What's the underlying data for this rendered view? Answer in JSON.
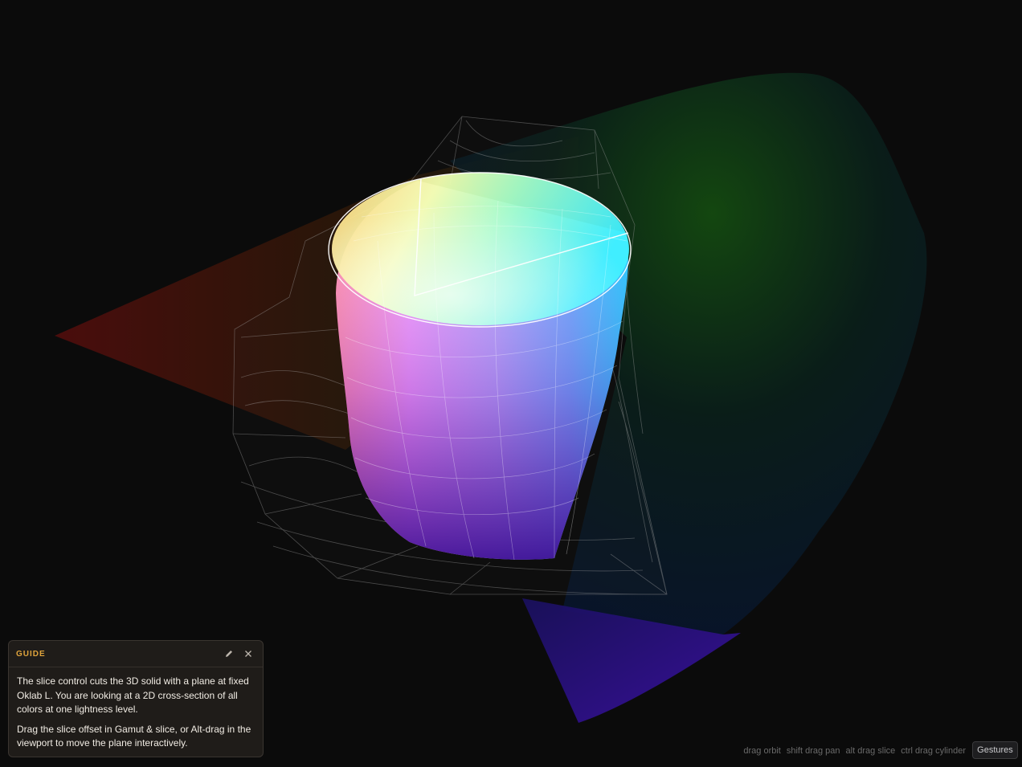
{
  "guide": {
    "title": "GUIDE",
    "edit_icon": "pencil-icon",
    "close_icon": "close-icon",
    "paragraphs": [
      "The slice control cuts the 3D solid with a plane at fixed Oklab L. You are looking at a 2D cross-section of all colors at one lightness level.",
      "Drag the slice offset in Gamut & slice, or Alt-drag in the viewport to move the plane interactively."
    ]
  },
  "hints": {
    "orbit": "drag orbit",
    "pan": "shift drag pan",
    "slice": "alt drag slice",
    "cylinder": "ctrl drag cylinder"
  },
  "gestures_button": "Gestures",
  "colors": {
    "background": "#0b0b0b",
    "guide_accent": "#e0a43c",
    "guide_panel": "#1f1c19"
  }
}
